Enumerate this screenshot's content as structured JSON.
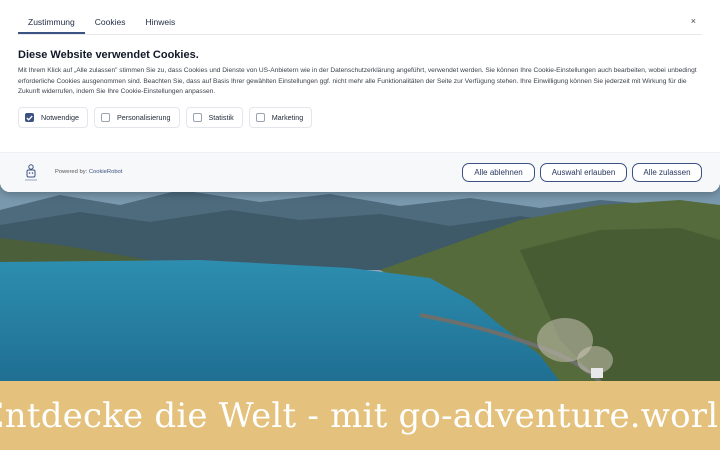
{
  "dialog": {
    "tabs": [
      {
        "label": "Zustimmung",
        "active": true
      },
      {
        "label": "Cookies",
        "active": false
      },
      {
        "label": "Hinweis",
        "active": false
      }
    ],
    "close_label": "×",
    "title": "Diese Website verwendet Cookies.",
    "description": "Mit Ihrem Klick auf „Alle zulassen\" stimmen Sie zu, dass Cookies und Dienste von US-Anbietern wie in der Datenschutzerklärung angeführt, verwendet werden. Sie können Ihre Cookie-Einstellungen auch bearbeiten, wobei unbedingt erforderliche Cookies ausgenommen sind. Beachten Sie, dass auf Basis Ihrer gewählten Einstellungen ggf. nicht mehr alle Funktionalitäten der Seite zur Verfügung stehen. Ihre Einwilligung können Sie jederzeit mit Wirkung für die Zukunft widerrufen, indem Sie Ihre Cookie-Einstellungen anpassen.",
    "checkboxes": [
      {
        "label": "Notwendige",
        "checked": true
      },
      {
        "label": "Personalisierung",
        "checked": false
      },
      {
        "label": "Statistik",
        "checked": false
      },
      {
        "label": "Marketing",
        "checked": false
      }
    ],
    "footer": {
      "powered_prefix": "Powered by:",
      "powered_link": "CookieRobot",
      "buttons": {
        "reject": "Alle ablehnen",
        "allow_selection": "Auswahl erlauben",
        "allow_all": "Alle zulassen"
      }
    },
    "colors": {
      "accent": "#3b5283"
    }
  },
  "banner": {
    "text": "Entdecke die Welt - mit go-adventure.world",
    "color": "#e4c17c"
  }
}
